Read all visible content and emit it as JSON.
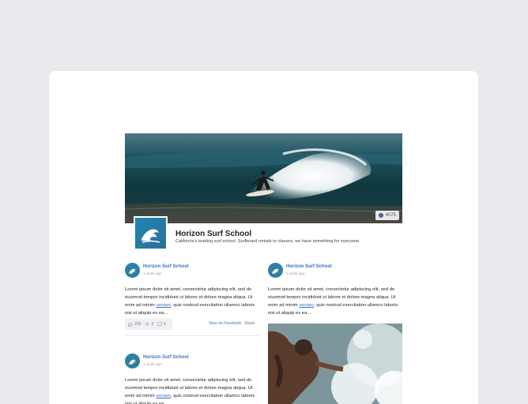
{
  "page": {
    "name": "Horizon Surf School",
    "description": "California's leading surf school. Surfboard rentals to classes, we have something for everyone.",
    "likes": "4075"
  },
  "posts": [
    {
      "author": "Horizon Surf School",
      "time": "1 week ago",
      "text_before": "Lorem ipsum dolor sit amet, consectetur adipiscing elit, sed do eiusmod tempor incididunt ut labore et dolore magna aliqua. Ut enim ad minim ",
      "link": "veniam",
      "text_after": ", quis nostrud exercitation ullamco laboris nisi ut aliquip ex ea...",
      "likes": "229",
      "shares": "3",
      "comments": "4",
      "view_on_facebook": "View on Facebook",
      "share_label": "Share"
    },
    {
      "author": "Horizon Surf School",
      "time": "1 week ago",
      "text_before": "Lorem ipsum dolor sit amet, consectetur adipiscing elit, sed do eiusmod tempor incididunt ut labore et dolore magna aliqua. Ut enim ad minim ",
      "link": "veniam",
      "text_after": ", quis nostrud exercitation ullamco laboris nisi ut aliquip ex ea..."
    },
    {
      "author": "Horizon Surf School",
      "time": "1 week ago",
      "text_before": "Lorem ipsum dolor sit amet, consectetur adipiscing elit, sed do eiusmod tempor incididunt ut labore et dolore magna aliqua. Ut enim ad minim ",
      "link": "veniam",
      "text_after": ", quis nostrud exercitation ullamco laboris nisi ut aliquip ex ea..."
    }
  ],
  "icons": {
    "facebook": "facebook-icon",
    "like": "thumbs-up-icon",
    "share": "share-icon",
    "comment": "comment-icon",
    "logo": "wave-logo-icon"
  },
  "colors": {
    "link": "#3b73b9",
    "avatar_bg": "#2d7fa3",
    "page_bg": "#e9e9ee"
  }
}
